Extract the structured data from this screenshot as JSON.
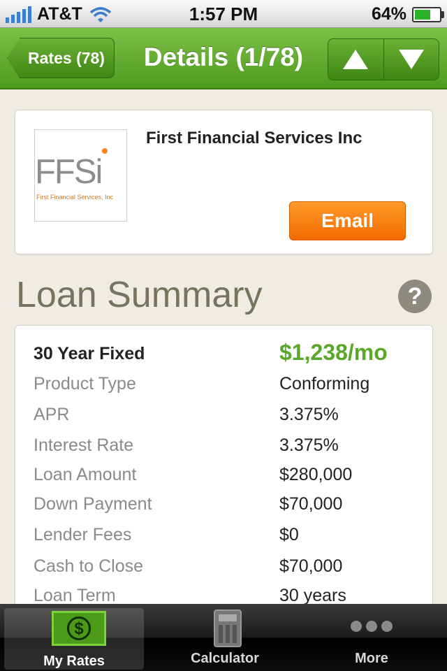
{
  "status_bar": {
    "carrier": "AT&T",
    "time": "1:57 PM",
    "battery": "64%",
    "battery_level": 0.64
  },
  "nav": {
    "back_label": "Rates (78)",
    "title": "Details (1/78)"
  },
  "lender": {
    "logo_text": "FFSi",
    "logo_subtext": "First Financial Services, Inc",
    "name": "First Financial Services Inc",
    "email_label": "Email"
  },
  "summary": {
    "title": "Loan Summary",
    "help_label": "?",
    "product": "30 Year Fixed",
    "payment": "$1,238/mo",
    "rows": [
      {
        "label": "Product Type",
        "value": "Conforming"
      },
      {
        "label": "APR",
        "value": "3.375%"
      },
      {
        "label": "Interest Rate",
        "value": "3.375%"
      },
      {
        "label": "Loan Amount",
        "value": "$280,000"
      },
      {
        "label": "Down Payment",
        "value": "$70,000"
      },
      {
        "label": "Lender Fees",
        "value": "$0"
      },
      {
        "label": "Cash to Close",
        "value": "$70,000"
      },
      {
        "label": "Loan Term",
        "value": "30 years"
      }
    ]
  },
  "tabs": [
    {
      "label": "My Rates",
      "icon": "money-icon",
      "active": true
    },
    {
      "label": "Calculator",
      "icon": "calculator-icon",
      "active": false
    },
    {
      "label": "More",
      "icon": "more-icon",
      "active": false
    }
  ],
  "colors": {
    "nav_green": "#5aa82a",
    "email_orange": "#f26a00",
    "payment_green": "#5aa82a"
  }
}
